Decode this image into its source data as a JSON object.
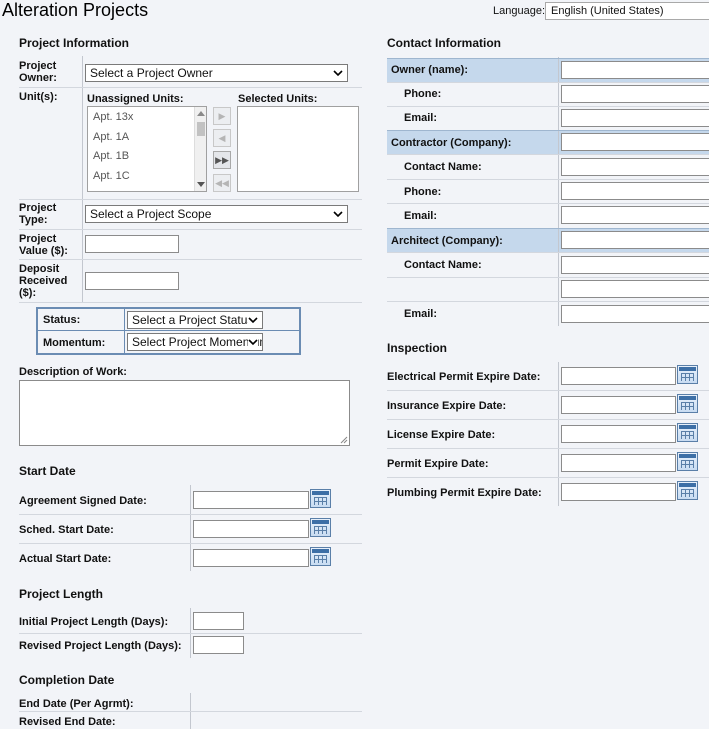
{
  "header": {
    "title": "Alteration Projects",
    "language_label": "Language:",
    "language_value": "English (United States)"
  },
  "project_info": {
    "heading": "Project Information",
    "owner_label_1": "Project",
    "owner_label_2": "Owner:",
    "owner_select": "Select a Project Owner",
    "units_label": "Unit(s):",
    "unassigned_label": "Unassigned Units:",
    "selected_label": "Selected Units:",
    "units": [
      "Apt. 13x",
      "Apt. 1A",
      "Apt. 1B",
      "Apt. 1C"
    ],
    "type_label_1": "Project",
    "type_label_2": "Type:",
    "type_select": "Select a Project Scope",
    "value_label_1": "Project",
    "value_label_2": "Value ($):",
    "deposit_label_1": "Deposit",
    "deposit_label_2": "Received",
    "deposit_label_3": "($):",
    "status_label": "Status:",
    "status_select": "Select a Project Status",
    "momentum_label": "Momentum:",
    "momentum_select": "Select Project Momentum",
    "description_label": "Description of Work:"
  },
  "start_date": {
    "heading": "Start Date",
    "agreement_label": "Agreement Signed Date:",
    "sched_label": "Sched. Start Date:",
    "actual_label": "Actual Start Date:"
  },
  "project_length": {
    "heading": "Project Length",
    "initial_label": "Initial Project Length (Days):",
    "revised_label": "Revised Project Length (Days):"
  },
  "completion_date": {
    "heading": "Completion Date",
    "end_label": "End Date (Per Agrmt):",
    "revised_end_label": "Revised End Date:"
  },
  "contact": {
    "heading": "Contact Information",
    "owner_label": "Owner (name):",
    "owner_phone": "Phone:",
    "owner_email": "Email:",
    "contractor_label": "Contractor (Company):",
    "contractor_contact": "Contact Name:",
    "contractor_phone": "Phone:",
    "contractor_email": "Email:",
    "architect_label": "Architect (Company):",
    "architect_contact": "Contact Name:",
    "architect_email": "Email:"
  },
  "inspection": {
    "heading": "Inspection",
    "electrical_label": "Electrical Permit Expire Date:",
    "insurance_label": "Insurance Expire Date:",
    "license_label": "License Expire Date:",
    "permit_label": "Permit Expire Date:",
    "plumbing_label": "Plumbing Permit Expire Date:"
  },
  "colors": {
    "page_bg": "#f2f4f8",
    "highlight_row": "#c5d8ec",
    "box_border": "#6b8cb3"
  },
  "icons": [
    "chevron-down-icon",
    "calendar-icon",
    "arrow-right-icon",
    "arrow-left-icon",
    "double-arrow-right-icon",
    "double-arrow-left-icon"
  ]
}
